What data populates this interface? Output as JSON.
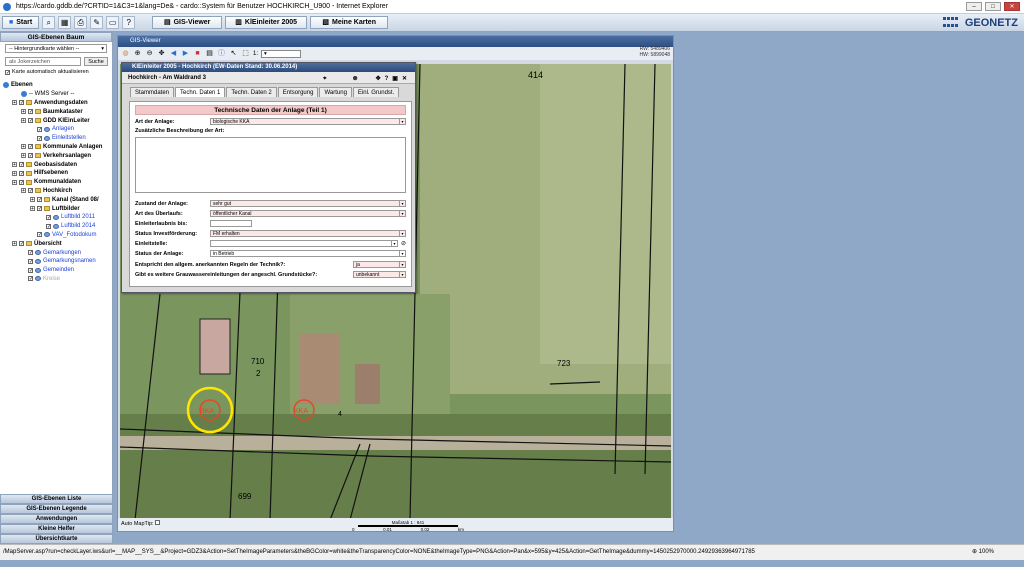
{
  "window": {
    "title": "https://cardo.gddb.de/?CRTID=1&C3=1&lang=De& - cardo::System für Benutzer HOCHKIRCH_U900 - Internet Explorer"
  },
  "toolbar": {
    "start_label": "Start",
    "gis_viewer_label": "GIS-Viewer",
    "einleiter_label": "KlEinleiter 2005",
    "karten_label": "Meine Karten",
    "logo": "GEONETZ"
  },
  "left": {
    "header": "GIS-Ebenen Baum",
    "bg_select": "-- Hintergrundkarte wählen --",
    "search_placeholder": "als Jokerzeichen",
    "search_button": "Suche",
    "auto_refresh": "Karte automatisch aktualisieren",
    "tree": [
      {
        "label": "Ebenen",
        "indent": 0,
        "type": "root"
      },
      {
        "label": "-- WMS Server --",
        "indent": 2,
        "type": "plain"
      },
      {
        "label": "Anwendungsdaten",
        "indent": 1,
        "type": "bold"
      },
      {
        "label": "Baumkataster",
        "indent": 2,
        "type": "bold"
      },
      {
        "label": "GDD KlEinLeiter",
        "indent": 2,
        "type": "bold"
      },
      {
        "label": "Anlagen",
        "indent": 3,
        "type": "link"
      },
      {
        "label": "Einleitstellen",
        "indent": 3,
        "type": "link"
      },
      {
        "label": "Kommunale Anlagen",
        "indent": 2,
        "type": "bold"
      },
      {
        "label": "Verkehrsanlagen",
        "indent": 2,
        "type": "bold"
      },
      {
        "label": "Geobasisdaten",
        "indent": 1,
        "type": "bold"
      },
      {
        "label": "Hilfsebenen",
        "indent": 1,
        "type": "bold"
      },
      {
        "label": "Kommunaldaten",
        "indent": 1,
        "type": "bold"
      },
      {
        "label": "Hochkirch",
        "indent": 2,
        "type": "bold"
      },
      {
        "label": "Kanal (Stand 08/",
        "indent": 3,
        "type": "bold"
      },
      {
        "label": "Luftbilder",
        "indent": 3,
        "type": "bold"
      },
      {
        "label": "Luftbild 2011",
        "indent": 4,
        "type": "link"
      },
      {
        "label": "Luftbild 2014",
        "indent": 4,
        "type": "link"
      },
      {
        "label": "VAV_Fotodokum",
        "indent": 3,
        "type": "link"
      },
      {
        "label": "Übersicht",
        "indent": 1,
        "type": "bold"
      },
      {
        "label": "Gemarkungen",
        "indent": 2,
        "type": "link"
      },
      {
        "label": "Gemarkungsnamen",
        "indent": 2,
        "type": "link"
      },
      {
        "label": "Gemeinden",
        "indent": 2,
        "type": "link"
      },
      {
        "label": "Kreise",
        "indent": 2,
        "type": "grey"
      }
    ],
    "bottom_tabs": [
      "GIS-Ebenen Liste",
      "GIS-Ebenen Legende",
      "Anwendungen",
      "Kleine Helfer",
      "Übersichtkarte"
    ]
  },
  "viewer": {
    "title": "GIS-Viewer",
    "scale_prefix": "1:",
    "coords": [
      "RW: 5489406",
      "HW: 5899048"
    ],
    "auto_maptip": "Auto MapTip:",
    "scale_label": "Maßstab 1 : 841",
    "scale_ticks": [
      "0",
      "0.01",
      "0.02",
      "km"
    ],
    "map_labels": {
      "parcel1": "414",
      "parcel2": "710",
      "parcel2b": "2",
      "parcel3": "723",
      "parcel4": "699",
      "parcel5": "4",
      "bka": "BKA",
      "kka": "KKA"
    }
  },
  "dialog": {
    "title": "KlEinleiter 2005 - Hochkirch (EW-Daten Stand: 30.06.2014)",
    "subtitle": "Hochkirch - Am Waldrand 3",
    "tabs": [
      "Stammdaten",
      "Techn. Daten 1",
      "Techn. Daten 2",
      "Entsorgung",
      "Wartung",
      "Einl. Grundst."
    ],
    "active_tab": 1,
    "section_title": "Technische Daten der Anlage (Teil 1)",
    "art_label": "Art der Anlage:",
    "art_value": "biologische KKA",
    "beschreibung_label": "Zusätzliche Beschreibung der Art:",
    "zustand_label": "Zustand der Anlage:",
    "zustand_value": "sehr gut",
    "ueberlauf_label": "Art des Überlaufs:",
    "ueberlauf_value": "öffentlicher Kanal",
    "erlaubnis_label": "Einleiterlaubnis bis:",
    "erlaubnis_value": "",
    "invest_label": "Status Investförderung:",
    "invest_value": "FM erhalten",
    "einleitstelle_label": "Einleitstelle:",
    "einleitstelle_value": "",
    "status_label": "Status der Anlage:",
    "status_value": "in Betrieb",
    "regeln_label": "Entspricht den allgem. anerkannten Regeln der Technik?:",
    "regeln_value": "ja",
    "grauwasser_label": "Gibt es weitere Grauwassereinleitungen der angeschl. Grundstücke?:",
    "grauwasser_value": "unbekannt"
  },
  "status": {
    "url": "/MapServer.asp?run=checkLayer.iws&url=__MAP__SYS__&Project=GDZ3&Action=SetTheImageParameters&theBGColor=white&theTransparencyColor=NONE&theImageType=PNG&Action=Pan&x=595&y=425&Action=GetTheImage&dummy=1450252970000.24929363964971785",
    "zoom": "100%"
  }
}
